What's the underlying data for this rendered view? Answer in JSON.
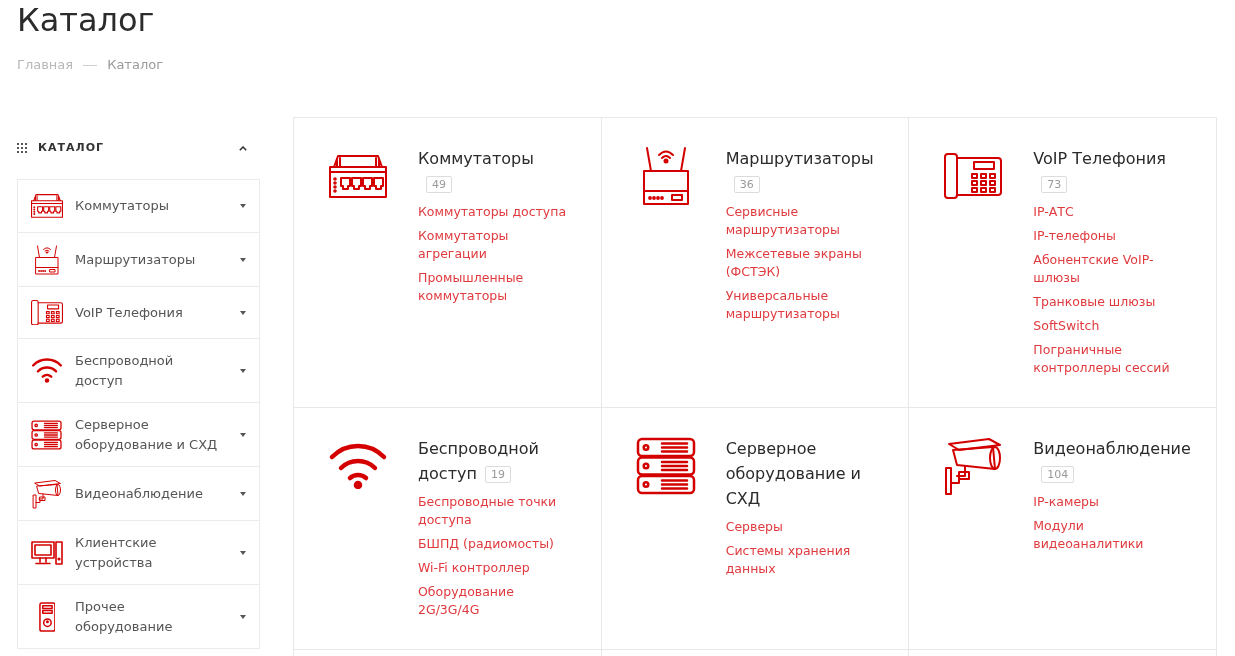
{
  "page": {
    "title": "Каталог"
  },
  "breadcrumbs": [
    {
      "label": "Главная",
      "current": false
    },
    {
      "label": "Каталог",
      "current": true
    }
  ],
  "sidebar": {
    "title": "КАТАЛОГ",
    "expanded": true,
    "items": [
      {
        "label": "Коммутаторы",
        "expanded": false
      },
      {
        "label": "Маршрутизаторы",
        "expanded": false
      },
      {
        "label": "VoIP Телефония",
        "expanded": false
      },
      {
        "label": "Беспроводной доступ",
        "expanded": false
      },
      {
        "label": "Серверное оборудование и СХД",
        "expanded": false
      },
      {
        "label": "Видеонаблюдение",
        "expanded": false
      },
      {
        "label": "Клиентские устройства",
        "expanded": false
      },
      {
        "label": "Прочее оборудование",
        "expanded": false
      }
    ]
  },
  "categories": [
    {
      "title": "Коммутаторы",
      "count": "49",
      "links": [
        "Коммутаторы доступа",
        "Коммутаторы агрегации",
        "Промышленные коммутаторы"
      ]
    },
    {
      "title": "Маршрутизаторы",
      "count": "36",
      "links": [
        "Сервисные маршрутизаторы",
        "Межсетевые экраны (ФСТЭК)",
        "Универсальные маршрутизаторы"
      ]
    },
    {
      "title": "VoIP Телефония",
      "count": "73",
      "links": [
        "IP-АТС",
        "IP-телефоны",
        "Абонентские VoIP-шлюзы",
        "Транковые шлюзы",
        "SoftSwitch",
        "Пограничные контроллеры сессий"
      ]
    },
    {
      "title": "Беспроводной доступ",
      "count": "19",
      "links": [
        "Беспроводные точки доступа",
        "БШПД (радиомосты)",
        "Wi-Fi контроллер",
        "Оборудование 2G/3G/4G"
      ]
    },
    {
      "title": "Серверное оборудование и СХД",
      "links": [
        "Серверы",
        "Системы хранения данных"
      ]
    },
    {
      "title": "Видеонаблюдение",
      "count": "104",
      "links": [
        "IP-камеры",
        "Модули видеоаналитики"
      ]
    }
  ]
}
